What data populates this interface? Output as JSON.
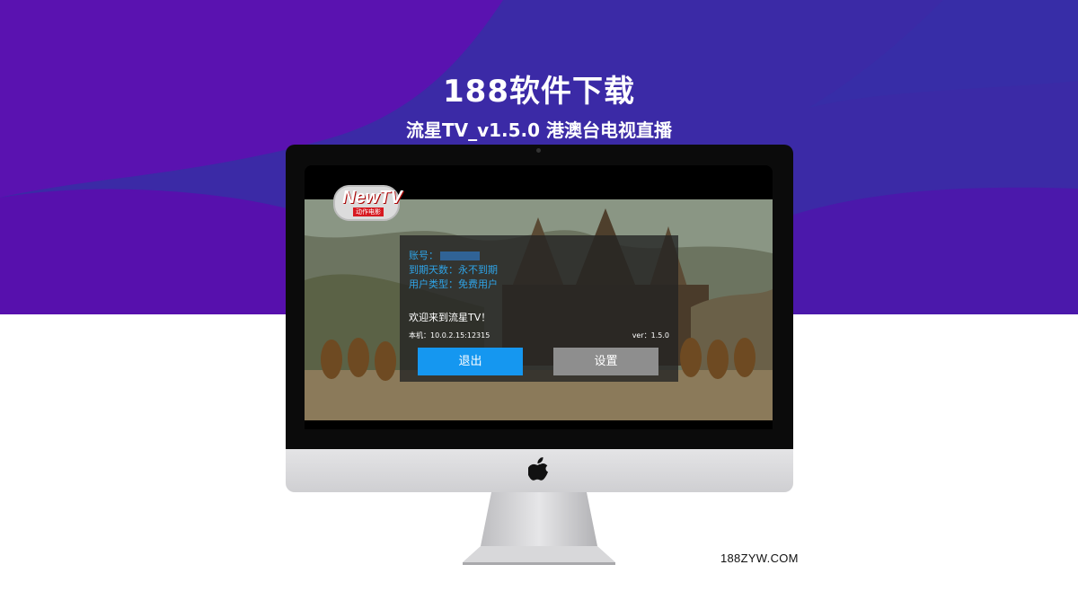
{
  "header": {
    "title": "188软件下载",
    "subtitle": "流星TV_v1.5.0 港澳台电视直播"
  },
  "app_screen": {
    "logo": {
      "main": "NewTV",
      "sub": "动作电影"
    },
    "account_label": "账号：",
    "expiry": "到期天数：永不到期",
    "user_type": "用户类型：免费用户",
    "welcome": "欢迎来到流星TV！",
    "local_address": "本机：10.0.2.15:12315",
    "version": "ver：1.5.0",
    "exit_button": "退出",
    "settings_button": "设置"
  },
  "watermark": "188ZYW.COM",
  "colors": {
    "hero_purple": "#3a28a8",
    "hero_violet": "#5b11b3",
    "accent_blue": "#1597f0",
    "button_gray": "#8e8e8e",
    "info_text": "#2fa3e6"
  },
  "icons": [
    "apple-logo-icon"
  ]
}
